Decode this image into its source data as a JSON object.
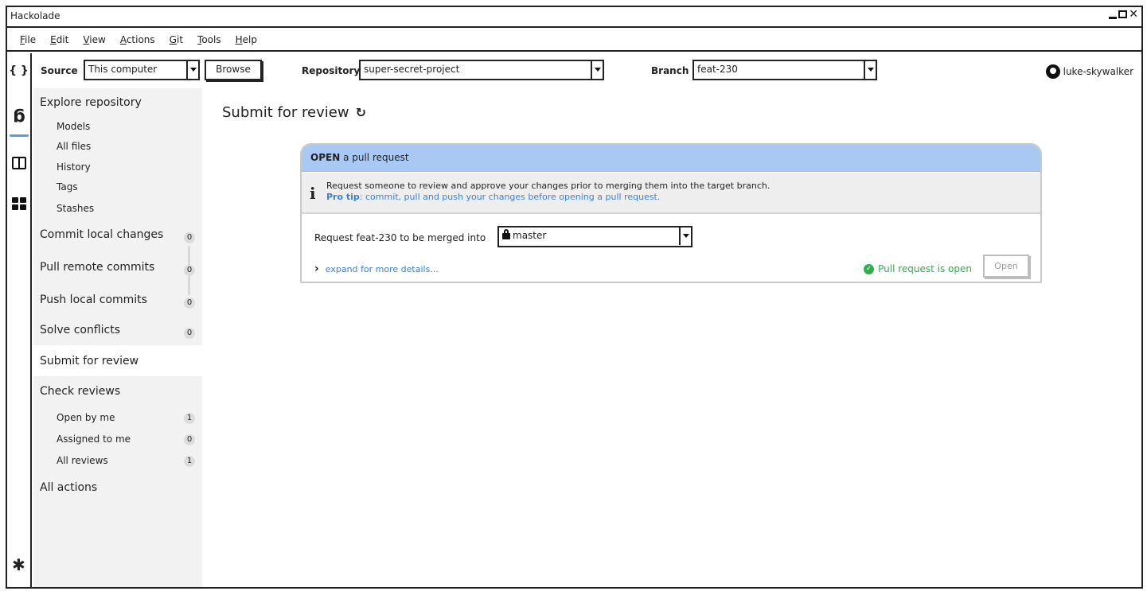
{
  "window": {
    "title": "Hackolade"
  },
  "menu": [
    "File",
    "Edit",
    "View",
    "Actions",
    "Git",
    "Tools",
    "Help"
  ],
  "toolbar": {
    "source_label": "Source",
    "source_value": "This computer",
    "browse_label": "Browse",
    "repository_label": "Repository",
    "repository_value": "super-secret-project",
    "branch_label": "Branch",
    "branch_value": "feat-230",
    "user": "luke-skywalker"
  },
  "sidebar": {
    "explore": {
      "label": "Explore repository",
      "items": [
        "Models",
        "All files",
        "History",
        "Tags",
        "Stashes"
      ]
    },
    "commit": {
      "label": "Commit local changes",
      "count": "0"
    },
    "pull": {
      "label": "Pull remote commits",
      "count": "0"
    },
    "push": {
      "label": "Push local commits",
      "count": "0"
    },
    "conflicts": {
      "label": "Solve conflicts",
      "count": "0"
    },
    "submit": {
      "label": "Submit for review"
    },
    "reviews": {
      "label": "Check reviews",
      "items": [
        {
          "label": "Open by me",
          "count": "1"
        },
        {
          "label": "Assigned to me",
          "count": "0"
        },
        {
          "label": "All reviews",
          "count": "1"
        }
      ]
    },
    "all_actions": {
      "label": "All actions"
    }
  },
  "main": {
    "title": "Submit for review",
    "card": {
      "header_bold": "OPEN",
      "header_rest": " a pull request",
      "info_line1": "Request someone to review and approve your changes prior to merging them into the target branch.",
      "protip_label": "Pro tip",
      "protip_text": ": commit, pull and push your changes before opening a pull request.",
      "request_text": "Request feat-230 to be merged into",
      "target_branch": "master",
      "expand_text": "expand for more details...",
      "status_text": "Pull request is open",
      "open_button": "Open"
    }
  },
  "colors": {
    "card_header": "#a9c8f2",
    "link": "#3a82d6",
    "success": "#2fae4b",
    "active_rail": "#5a9bd8"
  }
}
